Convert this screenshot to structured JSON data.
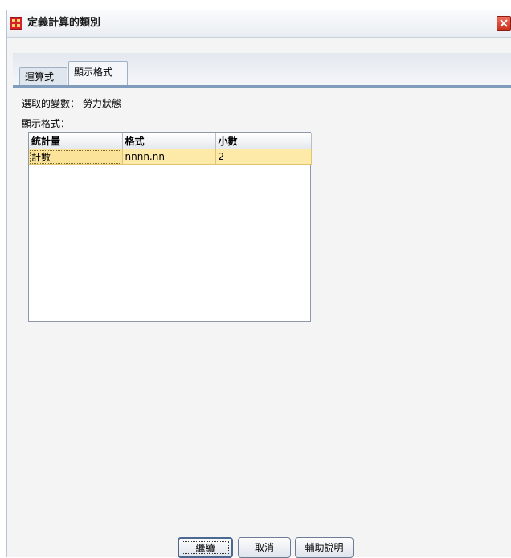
{
  "window": {
    "title": "定義計算的類別",
    "icon": "table-grid-icon",
    "close_icon": "close-icon"
  },
  "tabs": [
    {
      "label": "運算式",
      "active": false
    },
    {
      "label": "顯示格式",
      "active": true
    }
  ],
  "selected_variable": {
    "text": "選取的變數： 勞力狀態"
  },
  "display_format": {
    "label": "顯示格式：",
    "columns": [
      "統計量",
      "格式",
      "小數"
    ],
    "rows": [
      [
        "計數",
        "nnnn.nn",
        "2"
      ]
    ]
  },
  "buttons": {
    "continue": "繼續",
    "cancel": "取消",
    "help": "輔助說明"
  },
  "colors": {
    "row_highlight": "#fde9a8",
    "tab_accent": "#7f9cbd",
    "close_button": "#c9331f"
  }
}
